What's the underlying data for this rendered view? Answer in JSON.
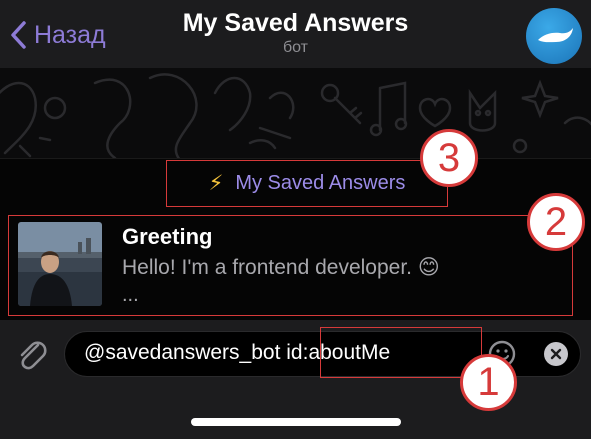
{
  "header": {
    "back_label": "Назад",
    "title": "My Saved Answers",
    "subtitle": "бот"
  },
  "results": {
    "switch_pm": {
      "icon": "lightning-icon",
      "label": "My Saved Answers"
    },
    "items": [
      {
        "title": "Greeting",
        "description": "Hello! I'm a frontend developer. 😊",
        "more": "..."
      }
    ]
  },
  "input": {
    "value": "@savedanswers_bot id:aboutMe"
  },
  "annotations": {
    "marker_1": "1",
    "marker_2": "2",
    "marker_3": "3"
  },
  "colors": {
    "accent": "#8d7bd6",
    "highlight": "#d63a3a",
    "background": "#000000",
    "bar": "#1c1c1e"
  }
}
